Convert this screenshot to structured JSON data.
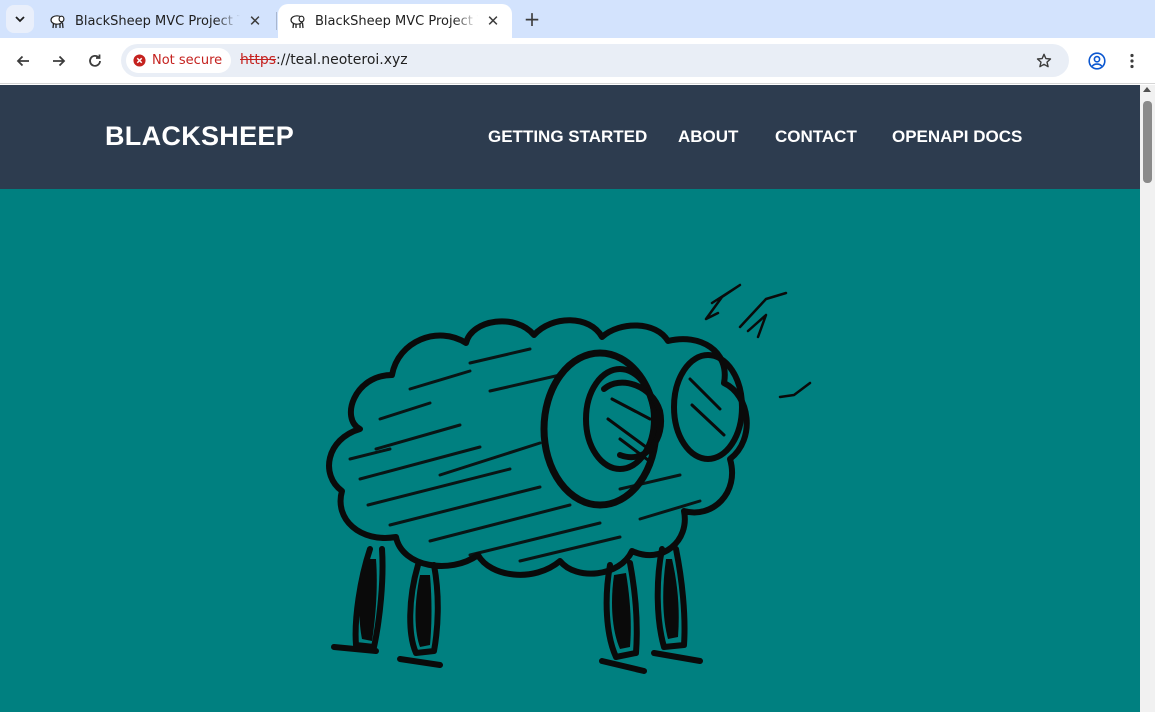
{
  "browser": {
    "tabs": [
      {
        "title": "BlackSheep MVC Project Template",
        "active": false
      },
      {
        "title": "BlackSheep MVC Project Template",
        "active": true
      }
    ],
    "security_chip": "Not secure",
    "url_scheme": "https",
    "url_rest": "://teal.neoteroi.xyz",
    "icons": {
      "tab_search": "chevron-down-icon",
      "back": "arrow-left-icon",
      "forward": "arrow-right-icon",
      "reload": "reload-icon",
      "bookmark": "star-icon",
      "profile": "profile-icon",
      "menu": "kebab-menu-icon"
    }
  },
  "site": {
    "brand": "BLACKSHEEP",
    "nav": [
      {
        "label": "GETTING STARTED"
      },
      {
        "label": "ABOUT"
      },
      {
        "label": "CONTACT"
      },
      {
        "label": "OPENAPI DOCS"
      }
    ],
    "colors": {
      "header_bg": "#2d3c4f",
      "hero_bg": "#008080",
      "text": "#ffffff"
    },
    "hero_image": "black-sheep-sketch"
  }
}
